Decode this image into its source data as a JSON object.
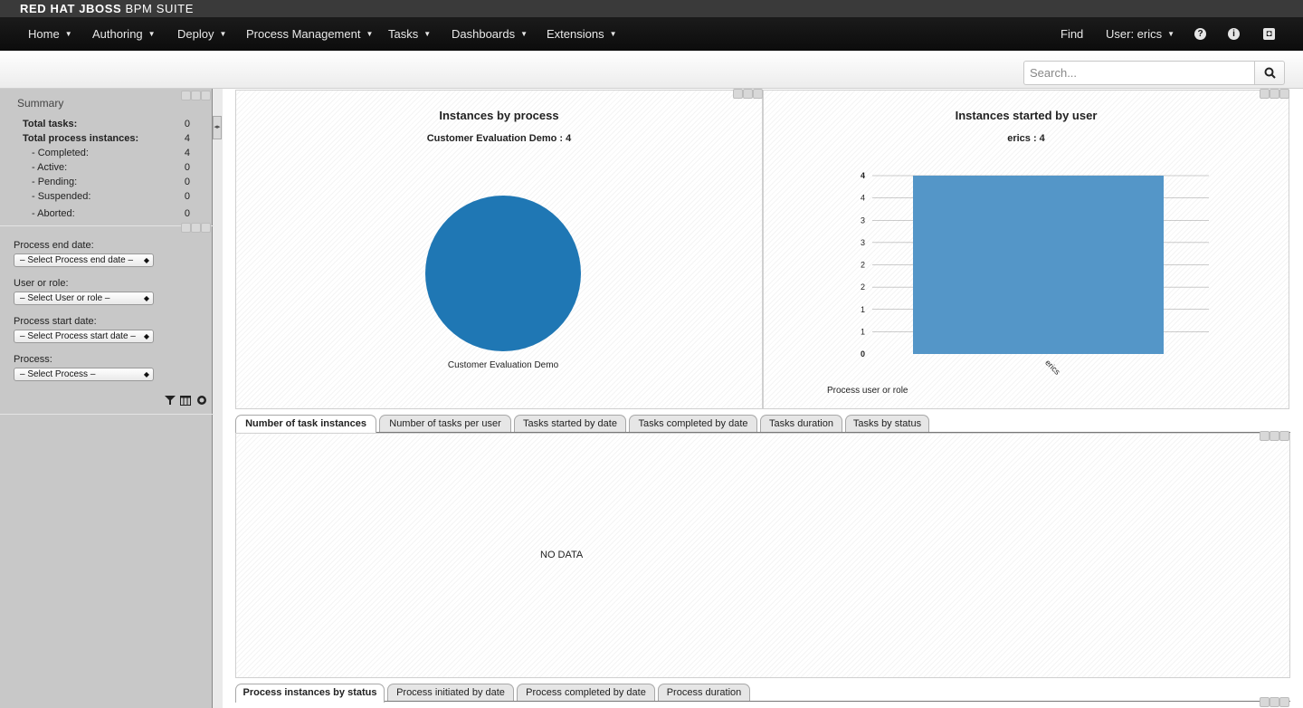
{
  "brand": {
    "prefix": "RED HAT JBOSS",
    "suffix": "BPM SUITE"
  },
  "nav": {
    "menus": [
      {
        "label": "Home"
      },
      {
        "label": "Authoring"
      },
      {
        "label": "Deploy"
      },
      {
        "label": "Process Management"
      },
      {
        "label": "Tasks"
      },
      {
        "label": "Dashboards"
      },
      {
        "label": "Extensions"
      }
    ],
    "find_label": "Find",
    "user_label": "User: erics",
    "icons": [
      "help-icon",
      "info-icon",
      "camera-icon"
    ]
  },
  "search": {
    "placeholder": "Search..."
  },
  "summary": {
    "title": "Summary",
    "rows": [
      {
        "label": "Total tasks:",
        "value": "0"
      },
      {
        "label": "Total process instances:",
        "value": "4"
      },
      {
        "label": "- Completed:",
        "value": "4"
      },
      {
        "label": "- Active:",
        "value": "0"
      },
      {
        "label": "- Pending:",
        "value": "0"
      },
      {
        "label": "- Suspended:",
        "value": "0"
      },
      {
        "label": "- Aborted:",
        "value": "0"
      }
    ]
  },
  "filters": [
    {
      "label": "Process end date:",
      "selected": "– Select Process end date –"
    },
    {
      "label": "User or role:",
      "selected": "– Select User or role –"
    },
    {
      "label": "Process start date:",
      "selected": "– Select Process start date –"
    },
    {
      "label": "Process:",
      "selected": "– Select Process –"
    }
  ],
  "filter_icons": [
    "filter-icon",
    "table-icon",
    "refresh-icon"
  ],
  "charts": {
    "pie_title": "Instances by process",
    "pie_subtitle": "Customer Evaluation Demo : 4",
    "bar_title": "Instances started by user",
    "bar_subtitle": "erics : 4",
    "bar_xlabel": "Process user or role"
  },
  "chart_data": [
    {
      "type": "pie",
      "title": "Instances by process",
      "subtitle": "Customer Evaluation Demo : 4",
      "categories": [
        "Customer Evaluation Demo"
      ],
      "values": [
        4
      ],
      "colors": [
        "#1f77b4"
      ]
    },
    {
      "type": "bar",
      "title": "Instances started by user",
      "subtitle": "erics : 4",
      "xlabel": "Process user or role",
      "ylabel": "",
      "categories": [
        "erics"
      ],
      "values": [
        4
      ],
      "ylim": [
        0,
        4
      ],
      "yticks": [
        "0",
        "1",
        "1",
        "2",
        "2",
        "3",
        "3",
        "4",
        "4"
      ],
      "grid": true,
      "colors": [
        "#5496c8"
      ]
    }
  ],
  "task_tabs": [
    {
      "label": "Number of task instances",
      "active": true
    },
    {
      "label": "Number of tasks per user"
    },
    {
      "label": "Tasks started by date"
    },
    {
      "label": "Tasks completed by date"
    },
    {
      "label": "Tasks duration"
    },
    {
      "label": "Tasks by status"
    }
  ],
  "no_data_text": "NO DATA",
  "process_tabs": [
    {
      "label": "Process instances by status",
      "active": true
    },
    {
      "label": "Process initiated by date"
    },
    {
      "label": "Process completed by date"
    },
    {
      "label": "Process duration"
    }
  ]
}
